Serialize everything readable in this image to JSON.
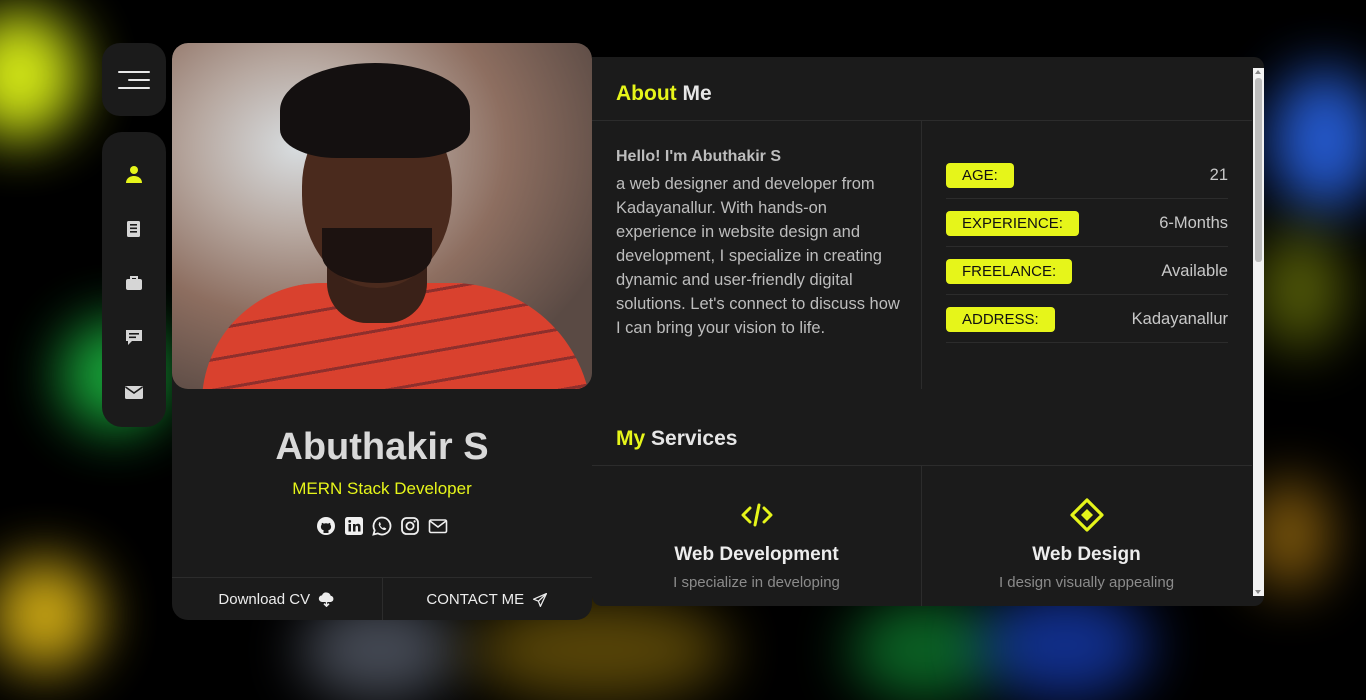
{
  "profile": {
    "name": "Abuthakir S",
    "role": "MERN Stack Developer",
    "download_label": "Download CV",
    "contact_label": "CONTACT ME",
    "socials": [
      "github-icon",
      "linkedin-icon",
      "whatsapp-icon",
      "instagram-icon",
      "mail-icon"
    ]
  },
  "nav": {
    "items": [
      "user-icon",
      "resume-icon",
      "briefcase-icon",
      "chat-icon",
      "envelope-icon"
    ],
    "active": 0
  },
  "about": {
    "title_highlight": "About",
    "title_rest": " Me",
    "hello": "Hello! I'm Abuthakir S",
    "bio": "a web designer and developer from Kadayanallur. With hands-on experience in website design and development, I specialize in creating dynamic and user-friendly digital solutions. Let's connect to discuss how I can bring your vision to life.",
    "info": [
      {
        "label": "AGE:",
        "value": "21"
      },
      {
        "label": "EXPERIENCE:",
        "value": "6-Months"
      },
      {
        "label": "FREELANCE:",
        "value": "Available"
      },
      {
        "label": "ADDRESS:",
        "value": "Kadayanallur"
      }
    ]
  },
  "services": {
    "title_highlight": "My",
    "title_rest": " Services",
    "items": [
      {
        "title": "Web Development",
        "desc": "I specialize in developing",
        "icon": "code-icon"
      },
      {
        "title": "Web Design",
        "desc": "I design visually appealing",
        "icon": "diamond-target-icon"
      }
    ]
  },
  "colors": {
    "accent": "#e6f51a",
    "card": "#1b1b1b",
    "background": "#000000"
  }
}
